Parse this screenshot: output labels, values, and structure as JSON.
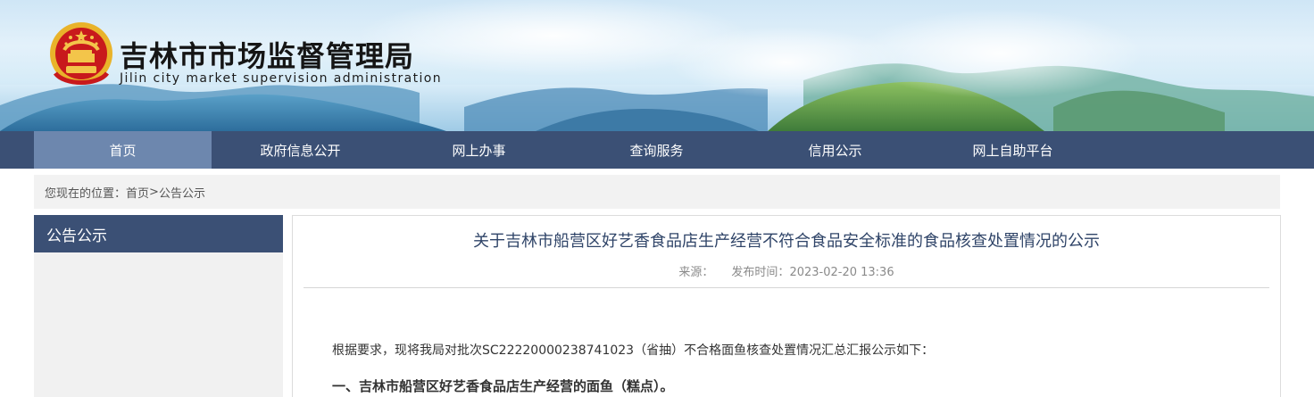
{
  "header": {
    "title": "吉林市市场监督管理局",
    "subtitle": "Jilin city market supervision administration",
    "emblem_icon": "national-emblem-icon"
  },
  "nav": {
    "items": [
      {
        "label": "首页",
        "active": true
      },
      {
        "label": "政府信息公开",
        "active": false
      },
      {
        "label": "网上办事",
        "active": false
      },
      {
        "label": "查询服务",
        "active": false
      },
      {
        "label": "信用公示",
        "active": false
      },
      {
        "label": "网上自助平台",
        "active": false
      }
    ]
  },
  "breadcrumb": {
    "prefix": "您现在的位置：",
    "home": "首页",
    "separator": ">",
    "current": "公告公示"
  },
  "sidebar": {
    "heading": "公告公示"
  },
  "article": {
    "title": "关于吉林市船营区好艺香食品店生产经营不符合食品安全标准的食品核查处置情况的公示",
    "source_label": "来源：",
    "publish_label": "发布时间：",
    "publish_time": "2023-02-20 13:36",
    "intro": "根据要求，现将我局对批次SC22220000238741023（省抽）不合格面鱼核查处置情况汇总汇报公示如下：",
    "section_1": "一、吉林市船营区好艺香食品店生产经营的面鱼（糕点）。"
  },
  "colors": {
    "nav_bg": "#3b5075",
    "nav_active": "#6d87ae",
    "title_color": "#2f4468"
  }
}
